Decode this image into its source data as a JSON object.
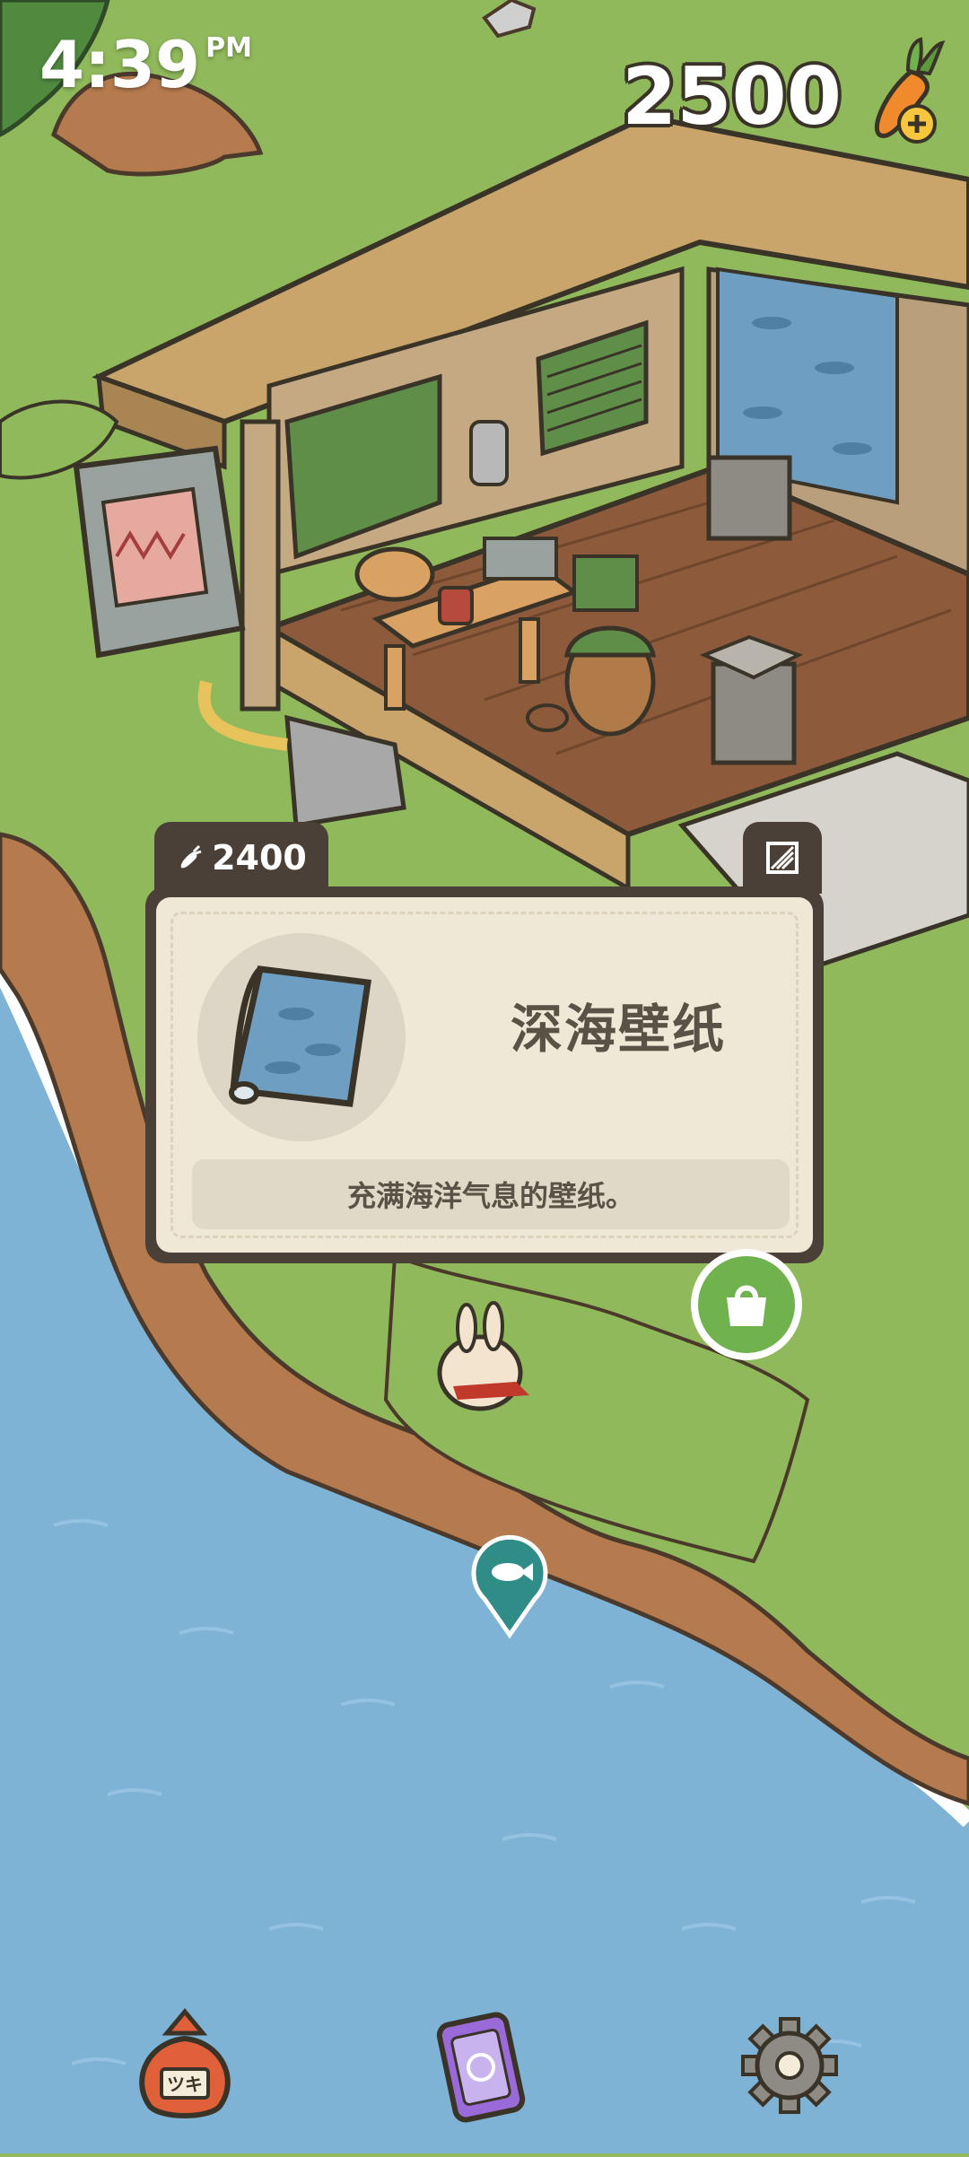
{
  "status_bar": {
    "time": "4:39",
    "ampm": "PM"
  },
  "currency": {
    "carrots": "2500"
  },
  "item_card": {
    "price": "2400",
    "name": "深海壁纸",
    "description": "充满海洋气息的壁纸。"
  },
  "bottom_nav": {
    "bag_label": "ツキ"
  },
  "colors": {
    "grass": "#8fb95a",
    "sea": "#7fb3d6",
    "card_frame": "#4b4038",
    "card_bg": "#efe8d6",
    "accent_green": "#6fb24e",
    "pin_teal": "#2f8c86"
  }
}
